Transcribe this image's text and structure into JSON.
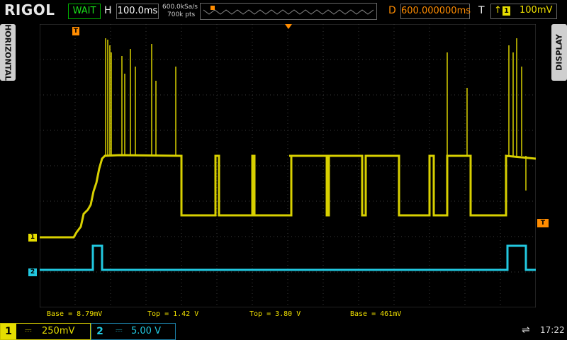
{
  "brand": "RIGOL",
  "trigger_status": "WAIT",
  "horizontal": {
    "label": "H",
    "timebase": "100.0ms",
    "sample_rate": "600.0kSa/s",
    "memory_depth": "700k pts"
  },
  "delay": {
    "label": "D",
    "value": "600.000000ms"
  },
  "trigger": {
    "label": "T",
    "source": "1",
    "level": "100mV"
  },
  "side_tabs": {
    "left": "HORIZONTAL",
    "right": "DISPLAY"
  },
  "markers": {
    "ch1": "1",
    "ch2": "2",
    "trigger_marker": "T"
  },
  "measurements": [
    {
      "text": "Base = 8.79mV"
    },
    {
      "text": "Top = 1.42 V"
    },
    {
      "text": "Top = 3.80 V"
    },
    {
      "text": "Base = 461mV"
    }
  ],
  "channels": [
    {
      "number": "1",
      "coupling": "DC",
      "scale": "250mV",
      "color": "#e6dd00"
    },
    {
      "number": "2",
      "coupling": "DC",
      "scale": "5.00 V",
      "color": "#1ec8d8"
    }
  ],
  "clock": "17:22",
  "colors": {
    "ch1": "#d8d000",
    "ch2": "#22c8e0",
    "trigger": "#ff8c00",
    "grid": "#3c3c3c"
  }
}
